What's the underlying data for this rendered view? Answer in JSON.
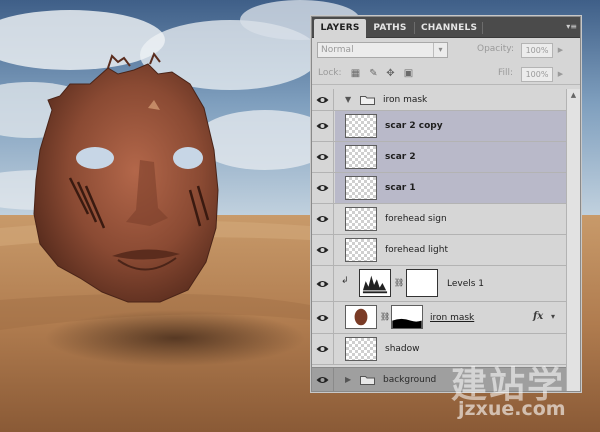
{
  "panel": {
    "tabs": [
      {
        "label": "LAYERS",
        "active": true
      },
      {
        "label": "PATHS",
        "active": false
      },
      {
        "label": "CHANNELS",
        "active": false
      }
    ],
    "menu_icon": "panel-menu-icon",
    "blend_mode": "Normal",
    "opacity_label": "Opacity:",
    "opacity_value": "100%",
    "lock_label": "Lock:",
    "fill_label": "Fill:",
    "fill_value": "100%",
    "lock_icons": [
      "lock-transparent-icon",
      "lock-image-icon",
      "lock-position-icon",
      "lock-all-icon"
    ]
  },
  "layers": [
    {
      "name": "iron mask",
      "kind": "group",
      "visible": true,
      "expanded": true
    },
    {
      "name": "scar 2 copy",
      "kind": "layer",
      "visible": true,
      "selected": true
    },
    {
      "name": "scar 2",
      "kind": "layer",
      "visible": true,
      "selected": true
    },
    {
      "name": "scar 1",
      "kind": "layer",
      "visible": true,
      "selected": true
    },
    {
      "name": "forehead sign",
      "kind": "layer",
      "visible": true,
      "selected": false
    },
    {
      "name": "forehead light",
      "kind": "layer",
      "visible": true,
      "selected": false
    },
    {
      "name": "Levels 1",
      "kind": "adjustment",
      "visible": true,
      "clipped": true
    },
    {
      "name": "iron mask",
      "kind": "masked-layer",
      "visible": true,
      "fx": true
    },
    {
      "name": "shadow",
      "kind": "layer",
      "visible": true,
      "selected": false
    },
    {
      "name": "background",
      "kind": "group",
      "visible": true,
      "expanded": false
    }
  ],
  "fx_label": "fx",
  "watermark": {
    "chinese": "建站学",
    "domain": "jzxue.com"
  },
  "colors": {
    "selection": "#b9b9c9",
    "panel_bg": "#d6d6d6",
    "tabbar": "#4b4b4b"
  }
}
